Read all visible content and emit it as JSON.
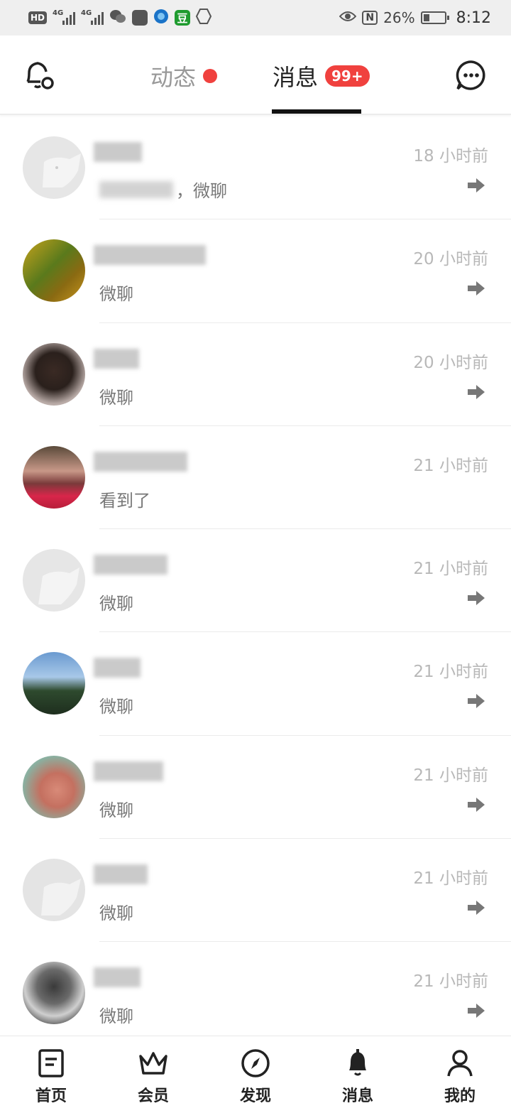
{
  "status_bar": {
    "time": "8:12",
    "battery": "26%",
    "hd": "HD",
    "net1": "4G",
    "net2": "4G",
    "icons": [
      "wechat-icon",
      "store-icon",
      "browser-icon",
      "douban-icon",
      "shield-icon",
      "eye-icon",
      "nfc-icon",
      "battery-icon"
    ],
    "douban_label": "豆",
    "nfc_label": "N"
  },
  "header": {
    "tabs": [
      {
        "label": "动态",
        "active": false,
        "dot": true
      },
      {
        "label": "消息",
        "active": true,
        "badge": "99+"
      }
    ],
    "left_icon": "bell-settings-icon",
    "right_icon": "chat-bubble-icon"
  },
  "messages": [
    {
      "time": "18 小时前",
      "preview": "，微聊",
      "preview_blurred_prefix": true,
      "arrow": true,
      "avatar": "placeholder"
    },
    {
      "time": "20 小时前",
      "preview": "微聊",
      "arrow": true,
      "avatar": "photo-green"
    },
    {
      "time": "20 小时前",
      "preview": "微聊",
      "arrow": true,
      "avatar": "photo-dark"
    },
    {
      "time": "21 小时前",
      "preview": "看到了",
      "arrow": false,
      "avatar": "photo-red"
    },
    {
      "time": "21 小时前",
      "preview": "微聊",
      "arrow": true,
      "avatar": "placeholder"
    },
    {
      "time": "21 小时前",
      "preview": "微聊",
      "arrow": true,
      "avatar": "photo-sky"
    },
    {
      "time": "21 小时前",
      "preview": "微聊",
      "arrow": true,
      "avatar": "photo-face"
    },
    {
      "time": "21 小时前",
      "preview": "微聊",
      "arrow": true,
      "avatar": "placeholder"
    },
    {
      "time": "21 小时前",
      "preview": "微聊",
      "arrow": true,
      "avatar": "photo-bw"
    }
  ],
  "bottom_nav": [
    {
      "label": "首页",
      "icon": "home-doc-icon"
    },
    {
      "label": "会员",
      "icon": "crown-icon"
    },
    {
      "label": "发现",
      "icon": "compass-icon"
    },
    {
      "label": "消息",
      "icon": "bell-icon",
      "active": true
    },
    {
      "label": "我的",
      "icon": "person-icon"
    }
  ],
  "colors": {
    "accent_red": "#f0413e",
    "muted_text": "#999999",
    "time_text": "#b8b8b8"
  }
}
